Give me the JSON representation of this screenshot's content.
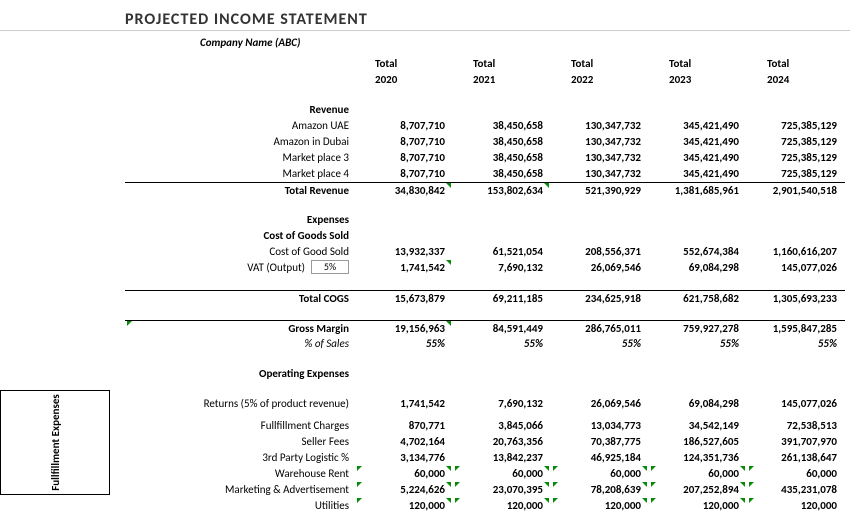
{
  "title": "PROJECTED  INCOME STATEMENT",
  "subtitle": "Company Name (ABC)",
  "side_tab": "Fullfillment Expenses",
  "chart_data": {
    "type": "table",
    "title": "Projected Income Statement",
    "years": [
      "2020",
      "2021",
      "2022",
      "2023",
      "2024"
    ],
    "revenue": {
      "Amazon UAE": [
        8707710,
        38450658,
        130347732,
        345421490,
        725385129
      ],
      "Amazon in Dubai": [
        8707710,
        38450658,
        130347732,
        345421490,
        725385129
      ],
      "Market place 3": [
        8707710,
        38450658,
        130347732,
        345421490,
        725385129
      ],
      "Market place 4": [
        8707710,
        38450658,
        130347732,
        345421490,
        725385129
      ],
      "Total Revenue": [
        34830842,
        153802634,
        521390929,
        1381685961,
        2901540518
      ]
    },
    "cogs": {
      "Cost of Good Sold": [
        13932337,
        61521054,
        208556371,
        552674384,
        1160616207
      ],
      "VAT (Output) 5%": [
        1741542,
        7690132,
        26069546,
        69084298,
        145077026
      ],
      "Total COGS": [
        15673879,
        69211185,
        234625918,
        621758682,
        1305693233
      ]
    },
    "gross_margin": {
      "values": [
        19156963,
        84591449,
        286765011,
        759927278,
        1595847285
      ],
      "pct_of_sales": [
        "55%",
        "55%",
        "55%",
        "55%",
        "55%"
      ]
    },
    "opex": {
      "Returns (5% of product revenue)": [
        1741542,
        7690132,
        26069546,
        69084298,
        145077026
      ],
      "Fullfillment Charges": [
        870771,
        3845066,
        13034773,
        34542149,
        72538513
      ],
      "Seller Fees": [
        4702164,
        20763356,
        70387775,
        186527605,
        391707970
      ],
      "3rd Party Logistic %": [
        3134776,
        13842237,
        46925184,
        124351736,
        261138647
      ],
      "Warehouse Rent": [
        60000,
        60000,
        60000,
        60000,
        60000
      ],
      "Marketing & Advertisement": [
        5224626,
        23070395,
        78208639,
        207252894,
        435231078
      ],
      "Utilities": [
        120000,
        120000,
        120000,
        120000,
        120000
      ]
    }
  },
  "headers": {
    "col_label": "Total",
    "years": [
      "2020",
      "2021",
      "2022",
      "2023",
      "2024"
    ]
  },
  "sections": {
    "revenue_hdr": "Revenue",
    "expenses_hdr": "Expenses",
    "cogs_hdr": "Cost of Goods Sold",
    "total_cogs": "Total COGS",
    "gross_margin": "Gross Margin",
    "pct_sales": "% of Sales",
    "opex_hdr": "Operating Expenses"
  },
  "rows": {
    "amazon_uae": {
      "label": "Amazon UAE",
      "v": [
        "8,707,710",
        "38,450,658",
        "130,347,732",
        "345,421,490",
        "725,385,129"
      ]
    },
    "amazon_dubai": {
      "label": "Amazon in Dubai",
      "v": [
        "8,707,710",
        "38,450,658",
        "130,347,732",
        "345,421,490",
        "725,385,129"
      ]
    },
    "mp3": {
      "label": "Market place 3",
      "v": [
        "8,707,710",
        "38,450,658",
        "130,347,732",
        "345,421,490",
        "725,385,129"
      ]
    },
    "mp4": {
      "label": "Market place 4",
      "v": [
        "8,707,710",
        "38,450,658",
        "130,347,732",
        "345,421,490",
        "725,385,129"
      ]
    },
    "total_rev": {
      "label": "Total Revenue",
      "v": [
        "34,830,842",
        "153,802,634",
        "521,390,929",
        "1,381,685,961",
        "2,901,540,518"
      ]
    },
    "cogs": {
      "label": "Cost of Good Sold",
      "v": [
        "13,932,337",
        "61,521,054",
        "208,556,371",
        "552,674,384",
        "1,160,616,207"
      ]
    },
    "vat": {
      "label": "VAT (Output)",
      "input": "5%",
      "v": [
        "1,741,542",
        "7,690,132",
        "26,069,546",
        "69,084,298",
        "145,077,026"
      ]
    },
    "total_cogs": {
      "v": [
        "15,673,879",
        "69,211,185",
        "234,625,918",
        "621,758,682",
        "1,305,693,233"
      ]
    },
    "gm": {
      "v": [
        "19,156,963",
        "84,591,449",
        "286,765,011",
        "759,927,278",
        "1,595,847,285"
      ]
    },
    "pct": {
      "v": [
        "55%",
        "55%",
        "55%",
        "55%",
        "55%"
      ]
    },
    "returns": {
      "label": "Returns (5% of product revenue)",
      "v": [
        "1,741,542",
        "7,690,132",
        "26,069,546",
        "69,084,298",
        "145,077,026"
      ]
    },
    "fulfill": {
      "label": "Fullfillment Charges",
      "v": [
        "870,771",
        "3,845,066",
        "13,034,773",
        "34,542,149",
        "72,538,513"
      ]
    },
    "seller": {
      "label": "Seller Fees",
      "v": [
        "4,702,164",
        "20,763,356",
        "70,387,775",
        "186,527,605",
        "391,707,970"
      ]
    },
    "tpl": {
      "label": "3rd Party Logistic %",
      "v": [
        "3,134,776",
        "13,842,237",
        "46,925,184",
        "124,351,736",
        "261,138,647"
      ]
    },
    "warehouse": {
      "label": "Warehouse Rent",
      "v": [
        "60,000",
        "60,000",
        "60,000",
        "60,000",
        "60,000"
      ]
    },
    "marketing": {
      "label": "Marketing  & Advertisement",
      "v": [
        "5,224,626",
        "23,070,395",
        "78,208,639",
        "207,252,894",
        "435,231,078"
      ]
    },
    "util": {
      "label": "Utilities",
      "v": [
        "120,000",
        "120,000",
        "120,000",
        "120,000",
        "120,000"
      ]
    }
  }
}
